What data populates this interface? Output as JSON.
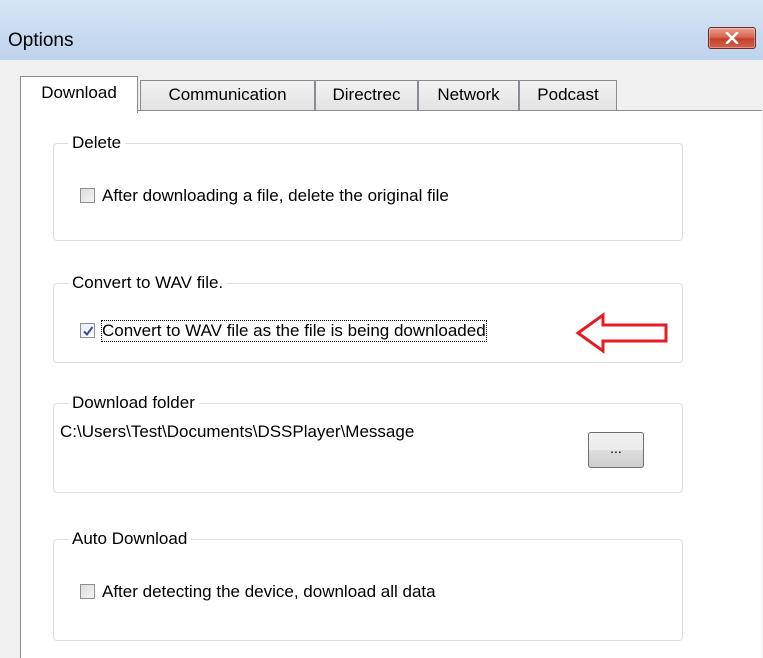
{
  "window": {
    "title": "Options"
  },
  "tabs": [
    {
      "label": "Download",
      "active": true
    },
    {
      "label": "Communication",
      "active": false
    },
    {
      "label": "Directrec",
      "active": false
    },
    {
      "label": "Network",
      "active": false
    },
    {
      "label": "Podcast",
      "active": false
    }
  ],
  "groups": {
    "delete": {
      "legend": "Delete",
      "checkbox_label": "After downloading a file, delete the original file",
      "checked": false
    },
    "convert": {
      "legend": "Convert to WAV file.",
      "checkbox_label": "Convert to WAV file as the file is being downloaded",
      "checked": true
    },
    "download_folder": {
      "legend": "Download folder",
      "path": "C:\\Users\\Test\\Documents\\DSSPlayer\\Message",
      "browse_label": "..."
    },
    "auto_download": {
      "legend": "Auto Download",
      "checkbox_label": "After detecting the device, download all data",
      "checked": false
    }
  },
  "icons": {
    "close": "close-x-icon",
    "annotation": "left-arrow-icon"
  },
  "colors": {
    "annotation_arrow": "#e51c23",
    "close_button": "#c4402a"
  }
}
